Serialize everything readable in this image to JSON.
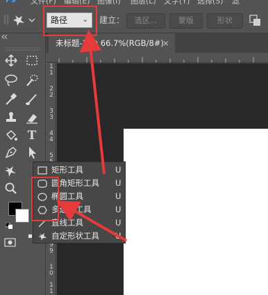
{
  "menubar": {
    "items": [
      "文件(F)",
      "编辑(E)",
      "图像(I)",
      "图层(L)",
      "文字(Y)",
      "选择(S)",
      "滤"
    ]
  },
  "options": {
    "mode_value": "路径",
    "make_label": "建立：",
    "selection_btn": "选区...",
    "mask_btn": "蒙版",
    "shape_btn": "形状"
  },
  "document": {
    "tab_title": "未标题-1 @ 66.7%(RGB/8#)",
    "close_glyph": "×"
  },
  "ruler": {
    "left_numbers": [
      "1",
      "1",
      "2",
      "2",
      "3",
      "3",
      "4",
      "4",
      "5",
      "5",
      "6",
      "6",
      "7",
      "7",
      "8",
      "8",
      "9",
      "9",
      "1",
      "0",
      "1",
      "1"
    ]
  },
  "flyout": {
    "items": [
      {
        "label": "矩形工具",
        "key": "U",
        "icon": "rectangle-icon"
      },
      {
        "label": "圆角矩形工具",
        "key": "U",
        "icon": "rounded-rectangle-icon"
      },
      {
        "label": "椭圆工具",
        "key": "U",
        "icon": "ellipse-icon"
      },
      {
        "label": "多边形工具",
        "key": "U",
        "icon": "polygon-icon"
      },
      {
        "label": "直线工具",
        "key": "U",
        "icon": "line-icon"
      },
      {
        "label": "自定形状工具",
        "key": "U",
        "icon": "custom-shape-icon",
        "active": true
      }
    ]
  },
  "colors": {
    "annotation_red": "#e53b3b",
    "panel": "#535353",
    "pasteboard": "#282828"
  }
}
